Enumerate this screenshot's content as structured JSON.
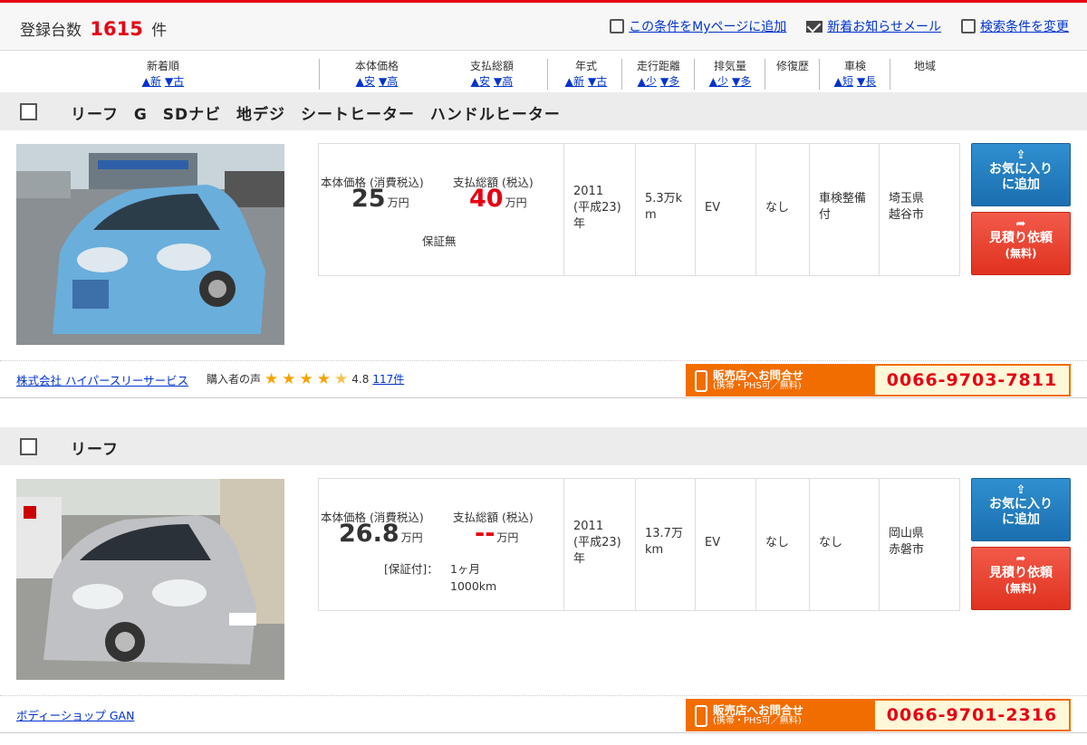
{
  "header": {
    "count_label": "登録台数",
    "count_value": "1615",
    "count_unit": "件",
    "links": [
      {
        "label": "この条件をMyページに追加",
        "icon": "add-page-icon"
      },
      {
        "label": "新着お知らせメール",
        "icon": "mail-icon"
      },
      {
        "label": "検索条件を変更",
        "icon": "search-change-icon"
      }
    ]
  },
  "sort": {
    "newest": {
      "label": "新着順",
      "a": "▲新",
      "b": "▼古"
    },
    "price": {
      "label": "本体価格",
      "a": "▲安",
      "b": "▼高"
    },
    "total": {
      "label": "支払総額",
      "a": "▲安",
      "b": "▼高"
    },
    "year": {
      "label": "年式",
      "a": "▲新",
      "b": "▼古"
    },
    "mileage": {
      "label": "走行距離",
      "a": "▲少",
      "b": "▼多"
    },
    "displacement": {
      "label": "排気量",
      "a": "▲少",
      "b": "▼多"
    },
    "repair": {
      "label": "修復歴"
    },
    "inspection": {
      "label": "車検",
      "a": "▲短",
      "b": "▼長"
    },
    "region": {
      "label": "地域"
    }
  },
  "listings": [
    {
      "title": "リーフ G SDナビ 地デジ シートヒーター ハンドルヒーター",
      "price_label": "本体価格 (消費税込)",
      "price_value": "25",
      "price_unit": "万円",
      "total_label": "支払総額 (税込)",
      "total_value": "40",
      "total_unit": "万円",
      "warranty": "保証無",
      "warranty_detail": "",
      "year": "2011\n(平成23)\n年",
      "mileage": "5.3万k\nm",
      "displacement": "EV",
      "repair": "なし",
      "inspection": "車検整備\n付",
      "region": "埼玉県\n越谷市",
      "dealer": "株式会社 ハイパースリーサービス",
      "review_label": "購入者の声",
      "rating": 4.8,
      "rating_text": "4.8",
      "review_count": "117件",
      "contact_label": "販売店へお問合せ",
      "contact_sub": "(携帯・PHS可／無料)",
      "phone": "0066-9703-7811"
    },
    {
      "title": "リーフ",
      "price_label": "本体価格 (消費税込)",
      "price_value": "26.8",
      "price_unit": "万円",
      "total_label": "支払総額 (税込)",
      "total_value": "--",
      "total_unit": "万円",
      "warranty": "[保証付]：",
      "warranty_detail": "1ヶ月\n1000km",
      "year": "2011\n(平成23)\n年",
      "mileage": "13.7万\nkm",
      "displacement": "EV",
      "repair": "なし",
      "inspection": "なし",
      "region": "岡山県\n赤磐市",
      "dealer": "ボディーショップ GAN",
      "contact_label": "販売店へお問合せ",
      "contact_sub": "(携帯・PHS可／無料)",
      "phone": "0066-9701-2316"
    }
  ],
  "buttons": {
    "favorite": "お気に入り\nに追加",
    "estimate": "見積り依頼",
    "estimate_sub": "(無料)"
  }
}
